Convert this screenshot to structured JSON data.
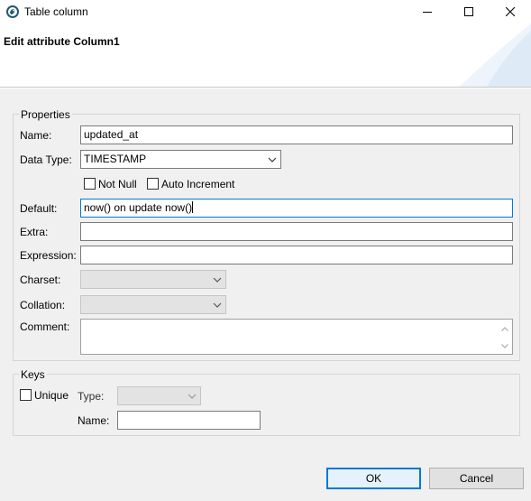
{
  "window": {
    "title": "Table column",
    "controls": [
      "minimize",
      "maximize",
      "close"
    ]
  },
  "header": {
    "title": "Edit attribute Column1"
  },
  "properties": {
    "group_label": "Properties",
    "name_label": "Name:",
    "name_value": "updated_at",
    "data_type_label": "Data Type:",
    "data_type_value": "TIMESTAMP",
    "not_null_label": "Not Null",
    "not_null_checked": false,
    "auto_increment_label": "Auto Increment",
    "auto_increment_checked": false,
    "default_label": "Default:",
    "default_value": "now() on update now()",
    "extra_label": "Extra:",
    "extra_value": "",
    "expression_label": "Expression:",
    "expression_value": "",
    "charset_label": "Charset:",
    "charset_value": "",
    "collation_label": "Collation:",
    "collation_value": "",
    "comment_label": "Comment:",
    "comment_value": ""
  },
  "keys": {
    "group_label": "Keys",
    "unique_label": "Unique",
    "unique_checked": false,
    "type_label": "Type:",
    "type_value": "",
    "name_label": "Name:",
    "name_value": ""
  },
  "buttons": {
    "ok_label": "OK",
    "cancel_label": "Cancel"
  },
  "colors": {
    "accent": "#0078d7",
    "dialog_bg": "#f0f0f0",
    "banner_bg": "#ffffff"
  }
}
